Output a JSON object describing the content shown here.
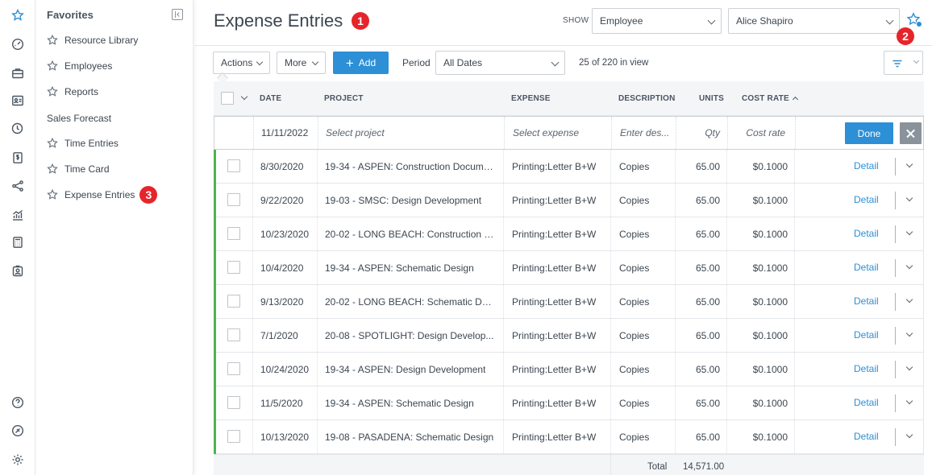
{
  "favorites": {
    "title": "Favorites",
    "items": [
      {
        "label": "Resource Library"
      },
      {
        "label": "Employees"
      },
      {
        "label": "Reports"
      }
    ],
    "group_label": "Sales Forecast",
    "group_items": [
      {
        "label": "Time Entries"
      },
      {
        "label": "Time Card"
      },
      {
        "label": "Expense Entries"
      }
    ]
  },
  "badges": {
    "one": "1",
    "two": "2",
    "three": "3"
  },
  "header": {
    "title": "Expense Entries",
    "show_label": "SHOW",
    "show_type": "Employee",
    "show_person": "Alice Shapiro"
  },
  "toolbar": {
    "actions_label": "Actions",
    "more_label": "More",
    "add_label": "Add",
    "period_label": "Period",
    "period_value": "All Dates",
    "count_text": "25 of 220 in view"
  },
  "table": {
    "columns": {
      "date": "DATE",
      "project": "PROJECT",
      "expense": "EXPENSE",
      "description": "DESCRIPTION",
      "units": "UNITS",
      "cost_rate": "COST RATE"
    },
    "new_row": {
      "date": "11/11/2022",
      "project_ph": "Select project",
      "expense_ph": "Select expense",
      "description_ph": "Enter des...",
      "units_ph": "Qty",
      "cost_rate_ph": "Cost rate",
      "done_label": "Done"
    },
    "rows": [
      {
        "date": "8/30/2020",
        "project": "19-34 - ASPEN: Construction Docume...",
        "expense": "Printing:Letter B+W",
        "description": "Copies",
        "units": "65.00",
        "cost_rate": "$0.1000",
        "detail": "Detail"
      },
      {
        "date": "9/22/2020",
        "project": "19-03 - SMSC: Design Development",
        "expense": "Printing:Letter B+W",
        "description": "Copies",
        "units": "65.00",
        "cost_rate": "$0.1000",
        "detail": "Detail"
      },
      {
        "date": "10/23/2020",
        "project": "20-02 - LONG BEACH: Construction D...",
        "expense": "Printing:Letter B+W",
        "description": "Copies",
        "units": "65.00",
        "cost_rate": "$0.1000",
        "detail": "Detail"
      },
      {
        "date": "10/4/2020",
        "project": "19-34 - ASPEN: Schematic Design",
        "expense": "Printing:Letter B+W",
        "description": "Copies",
        "units": "65.00",
        "cost_rate": "$0.1000",
        "detail": "Detail"
      },
      {
        "date": "9/13/2020",
        "project": "20-02 - LONG BEACH: Schematic Desi...",
        "expense": "Printing:Letter B+W",
        "description": "Copies",
        "units": "65.00",
        "cost_rate": "$0.1000",
        "detail": "Detail"
      },
      {
        "date": "7/1/2020",
        "project": "20-08 - SPOTLIGHT: Design Develop...",
        "expense": "Printing:Letter B+W",
        "description": "Copies",
        "units": "65.00",
        "cost_rate": "$0.1000",
        "detail": "Detail"
      },
      {
        "date": "10/24/2020",
        "project": "19-34 - ASPEN: Design Development",
        "expense": "Printing:Letter B+W",
        "description": "Copies",
        "units": "65.00",
        "cost_rate": "$0.1000",
        "detail": "Detail"
      },
      {
        "date": "11/5/2020",
        "project": "19-34 - ASPEN: Schematic Design",
        "expense": "Printing:Letter B+W",
        "description": "Copies",
        "units": "65.00",
        "cost_rate": "$0.1000",
        "detail": "Detail"
      },
      {
        "date": "10/13/2020",
        "project": "19-08 - PASADENA: Schematic Design",
        "expense": "Printing:Letter B+W",
        "description": "Copies",
        "units": "65.00",
        "cost_rate": "$0.1000",
        "detail": "Detail"
      }
    ],
    "footer": {
      "total_label": "Total",
      "total_value": "14,571.00"
    }
  },
  "colors": {
    "accent": "#2d8fd6",
    "badge": "#e5252b",
    "row_marker": "#4fb34f"
  }
}
